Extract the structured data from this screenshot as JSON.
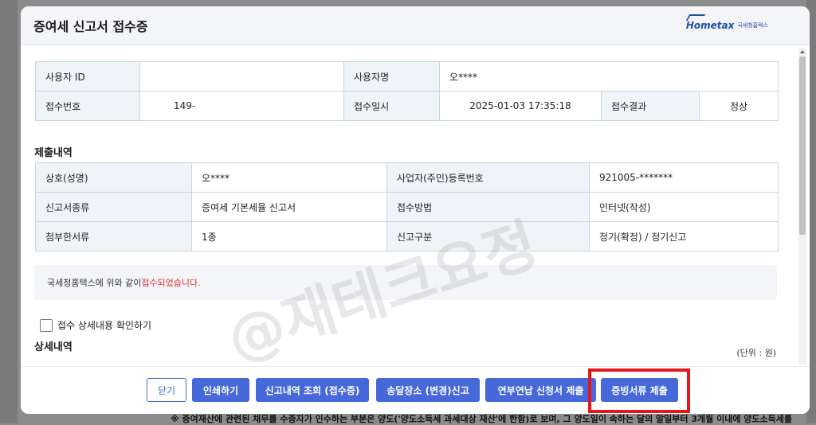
{
  "modal": {
    "title": "증여세 신고서 접수증"
  },
  "brand": {
    "logo_text": "Hometax",
    "sub_text": "국세청홈택스"
  },
  "receipt": {
    "row1": {
      "user_id_label": "사용자 ID",
      "user_id_value": "",
      "user_name_label": "사용자명",
      "user_name_value": "오****"
    },
    "row2": {
      "receipt_no_label": "접수번호",
      "receipt_no_value": "149-",
      "receipt_date_label": "접수일시",
      "receipt_date_value": "2025-01-03 17:35:18",
      "result_label": "접수결과",
      "result_value": "정상"
    }
  },
  "submission": {
    "title": "제출내역",
    "rows": [
      {
        "l1": "상호(성명)",
        "v1": "오****",
        "l2": "사업자(주민)등록번호",
        "v2": "921005-*******"
      },
      {
        "l1": "신고서종류",
        "v1": "증여세 기본세율 신고서",
        "l2": "접수방법",
        "v2": "인터넷(작성)"
      },
      {
        "l1": "첨부한서류",
        "v1": "1종",
        "l2": "신고구분",
        "v2": "정기(확정) / 정기신고"
      }
    ]
  },
  "notice": {
    "prefix": "국세청홈택스에 위와 같이 ",
    "highlight": "접수되었습니다."
  },
  "detail_check": {
    "label": "접수 상세내용 확인하기"
  },
  "detail": {
    "title": "상세내역",
    "unit": "(단위 : 원)"
  },
  "buttons": {
    "close": "닫기",
    "print": "인쇄하기",
    "history": "신고내역 조회 (접수증)",
    "address": "송달장소 (변경)신고",
    "installment": "연부연납 신청서 제출",
    "evidence": "증빙서류 제출"
  },
  "watermark": "@재테크요정",
  "background_note": "※ 증여재산에 관련된 채무를 수증자가 인수하는 부분은 양도('양도소득세 과세대상 재산'에 한함)로 보며, 그 양도일이 속하는 달의 말일부터 3개월 이내에 양도소득세를",
  "colors": {
    "accent": "#4668d8",
    "highlight_box": "#e8151a",
    "notice_red": "#e0312d"
  }
}
